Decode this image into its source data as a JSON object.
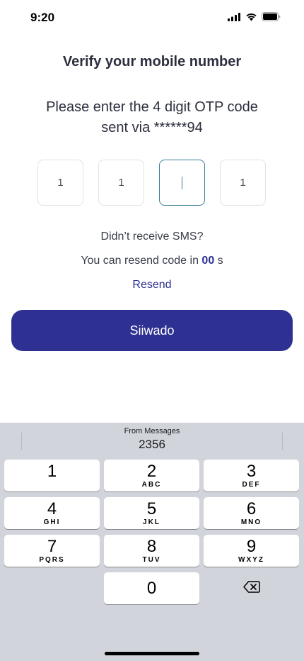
{
  "status_bar": {
    "time": "9:20",
    "icons": [
      "signal-icon",
      "wifi-icon",
      "battery-icon"
    ]
  },
  "header": {
    "title": "Verify your mobile number"
  },
  "instructions": {
    "line1": "Please enter the 4 digit OTP code",
    "line2": "sent via ******94"
  },
  "otp": {
    "digits": [
      "1",
      "1",
      "",
      "1"
    ],
    "active_index": 2
  },
  "resend": {
    "prompt": "Didn’t receive SMS?",
    "timer_prefix": "You can resend code in",
    "timer_value": "00",
    "timer_suffix": "s",
    "link_label": "Resend"
  },
  "primary_button": {
    "label": "Siiwado"
  },
  "keyboard": {
    "suggestion_caption": "From Messages",
    "suggestion_code": "2356",
    "keys": [
      {
        "digit": "1",
        "letters": ""
      },
      {
        "digit": "2",
        "letters": "ABC"
      },
      {
        "digit": "3",
        "letters": "DEF"
      },
      {
        "digit": "4",
        "letters": "GHI"
      },
      {
        "digit": "5",
        "letters": "JKL"
      },
      {
        "digit": "6",
        "letters": "MNO"
      },
      {
        "digit": "7",
        "letters": "PQRS"
      },
      {
        "digit": "8",
        "letters": "TUV"
      },
      {
        "digit": "9",
        "letters": "WXYZ"
      },
      {
        "digit": "0",
        "letters": ""
      }
    ],
    "delete_icon": "backspace-icon"
  },
  "colors": {
    "primary": "#2e3192",
    "active_border": "#3a7f99",
    "keyboard_bg": "#d1d4db"
  }
}
